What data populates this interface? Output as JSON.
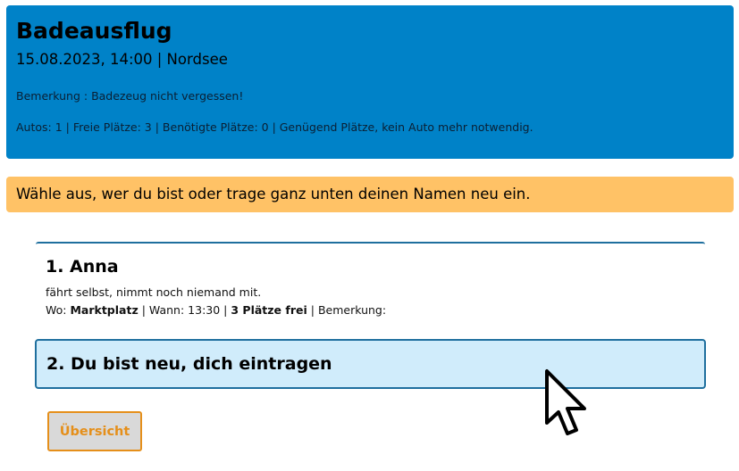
{
  "event": {
    "title": "Badeausflug",
    "datetime_location": "15.08.2023, 14:00 | Nordsee",
    "remark": "Bemerkung : Badezeug nicht vergessen!",
    "stats": "Autos: 1 | Freie Plätze: 3 | Benötigte Plätze: 0 | Genügend Plätze, kein Auto mehr notwendig."
  },
  "hint": "Wähle aus, wer du bist oder trage ganz unten deinen Namen neu ein.",
  "participants": [
    {
      "title": "1. Anna",
      "status": "fährt selbst, nimmt noch niemand mit.",
      "where_label": "Wo:",
      "where_value": "Marktplatz",
      "when_label": "Wann:",
      "when_value": "13:30",
      "seats": "3 Plätze frei",
      "remark_label": "Bemerkung:"
    }
  ],
  "new_entry_label": "2. Du bist neu, dich eintragen",
  "overview_button_label": "Übersicht",
  "colors": {
    "header_bg": "#0082c8",
    "hint_bg": "#ffc266",
    "card_border": "#1f6f9e",
    "new_entry_bg": "#d0ecfb",
    "button_accent": "#e58f1a"
  },
  "icons": {
    "cursor": "mouse-pointer-icon"
  }
}
